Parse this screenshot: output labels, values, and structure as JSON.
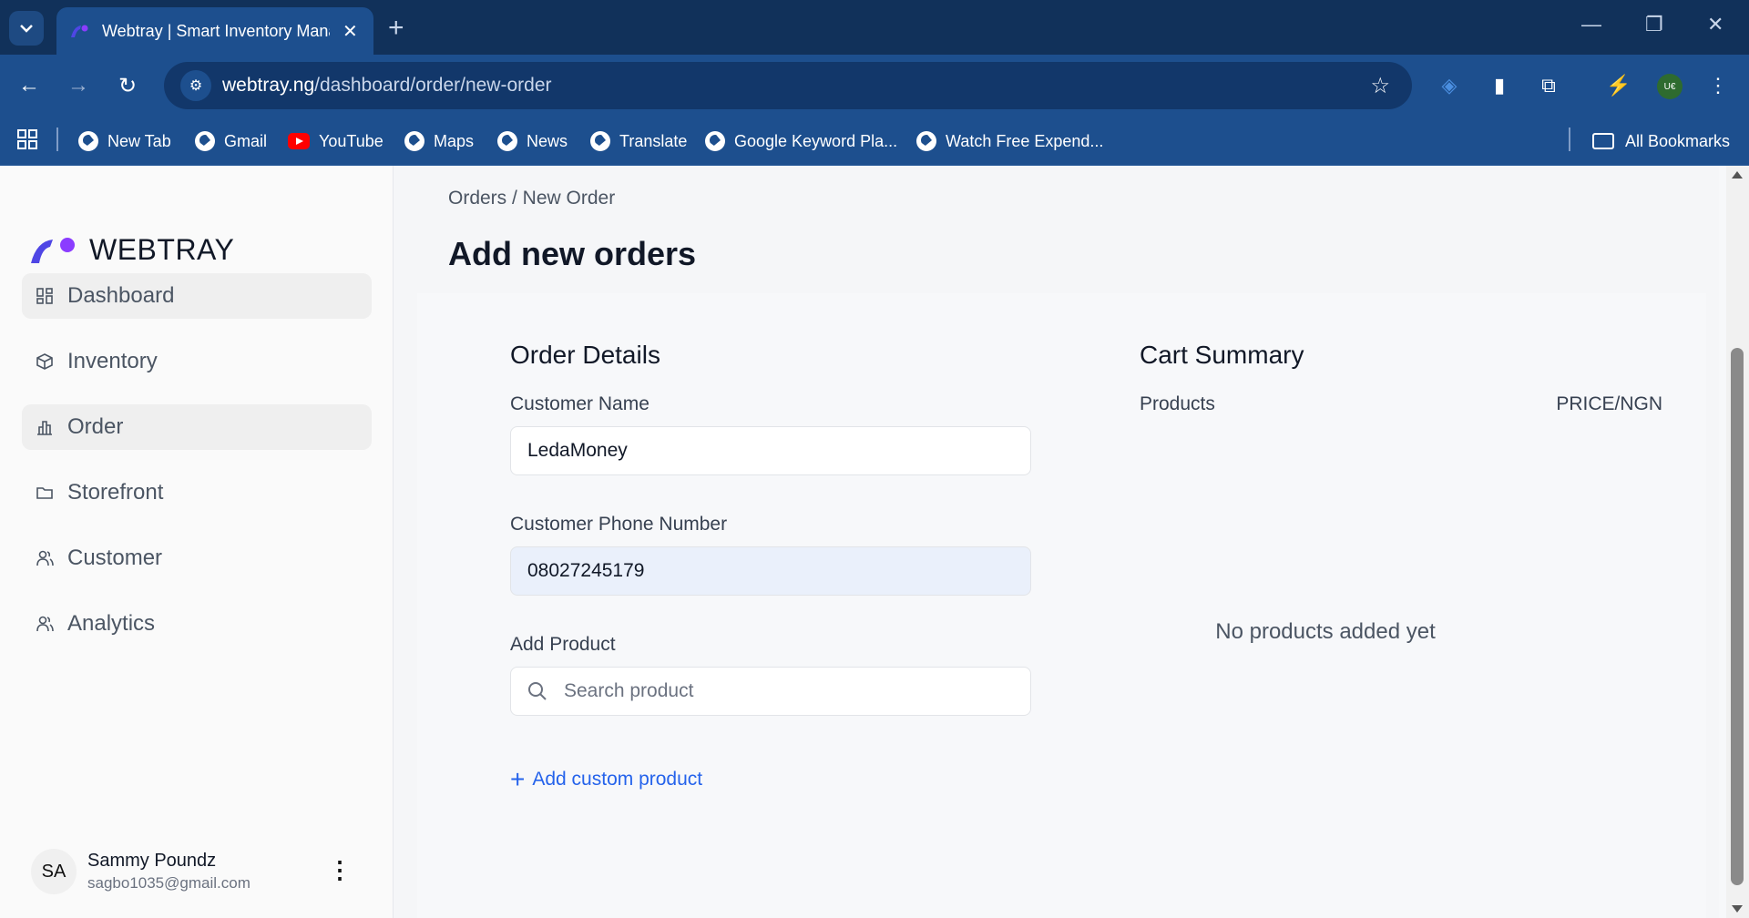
{
  "browser": {
    "tab_title": "Webtray | Smart Inventory Management",
    "url_domain": "webtray.ng",
    "url_path": "/dashboard/order/new-order",
    "profile_initials": "U€",
    "bookmarks": [
      {
        "label": "New Tab",
        "icon": "globe-icon"
      },
      {
        "label": "Gmail",
        "icon": "globe-icon"
      },
      {
        "label": "YouTube",
        "icon": "youtube-icon"
      },
      {
        "label": "Maps",
        "icon": "globe-icon"
      },
      {
        "label": "News",
        "icon": "globe-icon"
      },
      {
        "label": "Translate",
        "icon": "globe-icon"
      },
      {
        "label": "Google Keyword Pla...",
        "icon": "globe-icon"
      },
      {
        "label": "Watch Free Expend...",
        "icon": "globe-icon"
      }
    ],
    "all_bookmarks": "All Bookmarks"
  },
  "brand": {
    "name": "WEBTRAY",
    "accent": "#4f46e5",
    "dot": "#8b3dff"
  },
  "sidebar": {
    "items": [
      {
        "label": "Dashboard",
        "icon": "grid-icon",
        "active": true
      },
      {
        "label": "Inventory",
        "icon": "box-icon",
        "active": false
      },
      {
        "label": "Order",
        "icon": "chart-icon",
        "active": true
      },
      {
        "label": "Storefront",
        "icon": "folder-icon",
        "active": false
      },
      {
        "label": "Customer",
        "icon": "users-icon",
        "active": false
      },
      {
        "label": "Analytics",
        "icon": "users-icon",
        "active": false
      }
    ],
    "user": {
      "initials": "SA",
      "name": "Sammy Poundz",
      "email": "sagbo1035@gmail.com"
    }
  },
  "main": {
    "breadcrumb": "Orders / New Order",
    "title": "Add new orders",
    "order_details": {
      "heading": "Order Details",
      "customer_name_label": "Customer Name",
      "customer_name_value": "LedaMoney",
      "phone_label": "Customer Phone Number",
      "phone_value": "08027245179",
      "add_product_label": "Add Product",
      "search_placeholder": "Search product",
      "add_custom_label": "Add custom product"
    },
    "cart_summary": {
      "heading": "Cart Summary",
      "col_products": "Products",
      "col_price": "PRICE/NGN",
      "empty_message": "No products added yet"
    }
  }
}
